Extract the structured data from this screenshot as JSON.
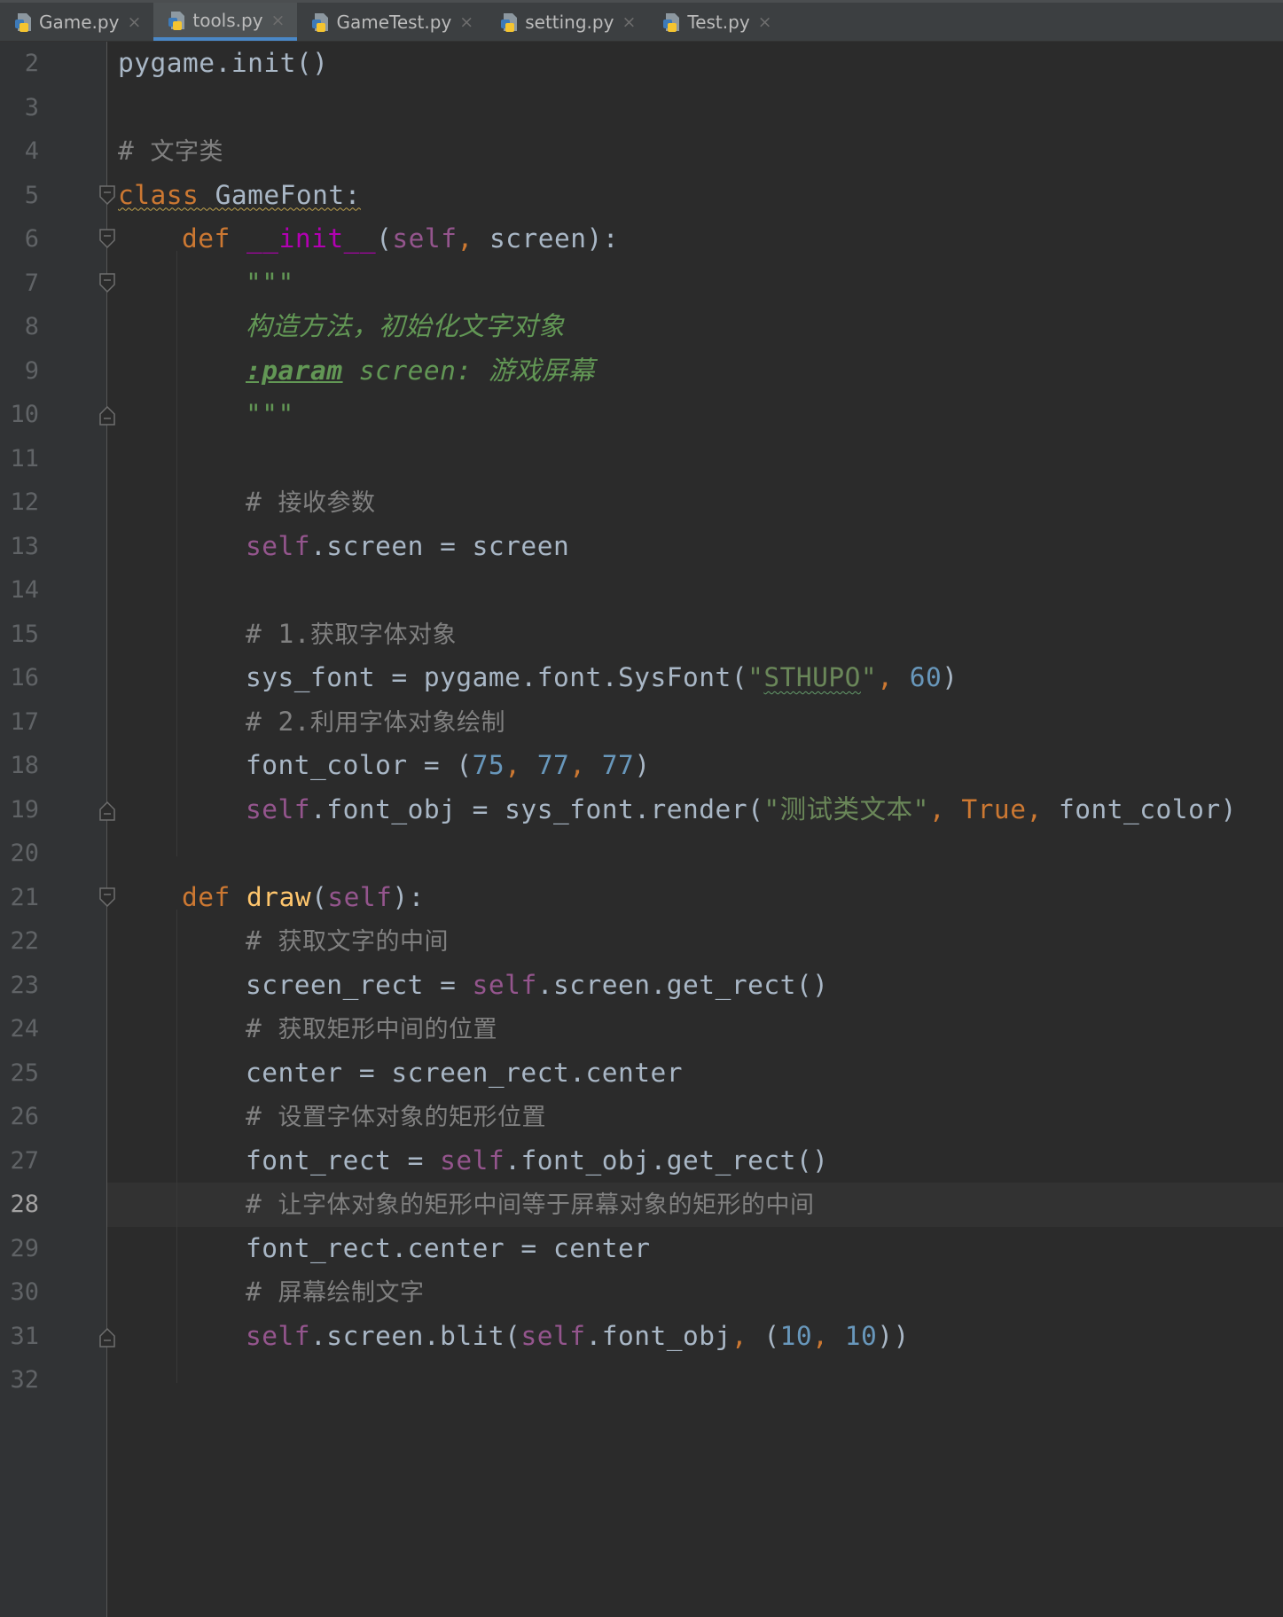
{
  "tabs": [
    {
      "label": "Game.py",
      "active": false
    },
    {
      "label": "tools.py",
      "active": true
    },
    {
      "label": "GameTest.py",
      "active": false
    },
    {
      "label": "setting.py",
      "active": false
    },
    {
      "label": "Test.py",
      "active": false
    }
  ],
  "close_glyph": "×",
  "editor": {
    "current_line": 28,
    "lines": [
      {
        "n": "2",
        "indent": 0,
        "fold": "",
        "tokens": [
          [
            "plain",
            "pygame.init()"
          ]
        ]
      },
      {
        "n": "3",
        "indent": 0,
        "fold": "",
        "tokens": []
      },
      {
        "n": "4",
        "indent": 0,
        "fold": "",
        "tokens": [
          [
            "cmt-mono",
            "# "
          ],
          [
            "cmt",
            "文字类"
          ]
        ]
      },
      {
        "n": "5",
        "indent": 0,
        "fold": "open",
        "tokens": [
          [
            "kw squiggle",
            "class"
          ],
          [
            "plain squiggle",
            " GameFont:"
          ]
        ]
      },
      {
        "n": "6",
        "indent": 1,
        "fold": "open",
        "tokens": [
          [
            "kw",
            "def "
          ],
          [
            "magic",
            "__init__"
          ],
          [
            "plain",
            "("
          ],
          [
            "self",
            "self"
          ],
          [
            "kw",
            ", "
          ],
          [
            "plain",
            "screen):"
          ]
        ]
      },
      {
        "n": "7",
        "indent": 2,
        "fold": "open",
        "tokens": [
          [
            "doc",
            "\"\"\""
          ]
        ]
      },
      {
        "n": "8",
        "indent": 2,
        "fold": "",
        "tokens": [
          [
            "doc",
            "构造方法，初始化文字对象"
          ]
        ]
      },
      {
        "n": "9",
        "indent": 2,
        "fold": "",
        "tokens": [
          [
            "doc-tag",
            ":param"
          ],
          [
            "doc",
            " screen: 游戏屏幕"
          ]
        ]
      },
      {
        "n": "10",
        "indent": 2,
        "fold": "close",
        "tokens": [
          [
            "doc",
            "\"\"\""
          ]
        ]
      },
      {
        "n": "11",
        "indent": 0,
        "fold": "",
        "tokens": []
      },
      {
        "n": "12",
        "indent": 2,
        "fold": "",
        "tokens": [
          [
            "cmt-mono",
            "# "
          ],
          [
            "cmt",
            "接收参数"
          ]
        ]
      },
      {
        "n": "13",
        "indent": 2,
        "fold": "",
        "tokens": [
          [
            "self",
            "self"
          ],
          [
            "plain",
            ".screen = screen"
          ]
        ]
      },
      {
        "n": "14",
        "indent": 0,
        "fold": "",
        "tokens": []
      },
      {
        "n": "15",
        "indent": 2,
        "fold": "",
        "tokens": [
          [
            "cmt-mono",
            "# 1."
          ],
          [
            "cmt",
            "获取字体对象"
          ]
        ]
      },
      {
        "n": "16",
        "indent": 2,
        "fold": "",
        "tokens": [
          [
            "plain",
            "sys_font = pygame.font.SysFont("
          ],
          [
            "str",
            "\""
          ],
          [
            "str squiggle-g",
            "STHUPO"
          ],
          [
            "str",
            "\""
          ],
          [
            "kw",
            ", "
          ],
          [
            "num",
            "60"
          ],
          [
            "plain",
            ")"
          ]
        ]
      },
      {
        "n": "17",
        "indent": 2,
        "fold": "",
        "tokens": [
          [
            "cmt-mono",
            "# 2."
          ],
          [
            "cmt",
            "利用字体对象绘制"
          ]
        ]
      },
      {
        "n": "18",
        "indent": 2,
        "fold": "",
        "tokens": [
          [
            "plain",
            "font_color = ("
          ],
          [
            "num",
            "75"
          ],
          [
            "kw",
            ", "
          ],
          [
            "num",
            "77"
          ],
          [
            "kw",
            ", "
          ],
          [
            "num",
            "77"
          ],
          [
            "plain",
            ")"
          ]
        ]
      },
      {
        "n": "19",
        "indent": 2,
        "fold": "close",
        "tokens": [
          [
            "self",
            "self"
          ],
          [
            "plain",
            ".font_obj = sys_font.render("
          ],
          [
            "str",
            "\"测试类文本\""
          ],
          [
            "kw",
            ", "
          ],
          [
            "kw",
            "True"
          ],
          [
            "kw",
            ", "
          ],
          [
            "plain",
            "font_color)"
          ]
        ]
      },
      {
        "n": "20",
        "indent": 0,
        "fold": "",
        "tokens": []
      },
      {
        "n": "21",
        "indent": 1,
        "fold": "open",
        "tokens": [
          [
            "kw",
            "def "
          ],
          [
            "fn",
            "draw"
          ],
          [
            "plain",
            "("
          ],
          [
            "self",
            "self"
          ],
          [
            "plain",
            "):"
          ]
        ]
      },
      {
        "n": "22",
        "indent": 2,
        "fold": "",
        "tokens": [
          [
            "cmt-mono",
            "# "
          ],
          [
            "cmt",
            "获取文字的中间"
          ]
        ]
      },
      {
        "n": "23",
        "indent": 2,
        "fold": "",
        "tokens": [
          [
            "plain",
            "screen_rect = "
          ],
          [
            "self",
            "self"
          ],
          [
            "plain",
            ".screen.get_rect()"
          ]
        ]
      },
      {
        "n": "24",
        "indent": 2,
        "fold": "",
        "tokens": [
          [
            "cmt-mono",
            "# "
          ],
          [
            "cmt",
            "获取矩形中间的位置"
          ]
        ]
      },
      {
        "n": "25",
        "indent": 2,
        "fold": "",
        "tokens": [
          [
            "plain",
            "center = screen_rect.center"
          ]
        ]
      },
      {
        "n": "26",
        "indent": 2,
        "fold": "",
        "tokens": [
          [
            "cmt-mono",
            "# "
          ],
          [
            "cmt",
            "设置字体对象的矩形位置"
          ]
        ]
      },
      {
        "n": "27",
        "indent": 2,
        "fold": "",
        "tokens": [
          [
            "plain",
            "font_rect = "
          ],
          [
            "self",
            "self"
          ],
          [
            "plain",
            ".font_obj.get_rect()"
          ]
        ]
      },
      {
        "n": "28",
        "indent": 2,
        "fold": "",
        "tokens": [
          [
            "cmt-mono",
            "# "
          ],
          [
            "cmt",
            "让字体对象的矩形中间等于屏幕对象的矩形的中间"
          ]
        ]
      },
      {
        "n": "29",
        "indent": 2,
        "fold": "",
        "tokens": [
          [
            "plain",
            "font_rect.center = center"
          ]
        ]
      },
      {
        "n": "30",
        "indent": 2,
        "fold": "",
        "tokens": [
          [
            "cmt-mono",
            "# "
          ],
          [
            "cmt",
            "屏幕绘制文字"
          ]
        ]
      },
      {
        "n": "31",
        "indent": 2,
        "fold": "close",
        "tokens": [
          [
            "self",
            "self"
          ],
          [
            "plain",
            ".screen.blit("
          ],
          [
            "self",
            "self"
          ],
          [
            "plain",
            ".font_obj"
          ],
          [
            "kw",
            ", "
          ],
          [
            "plain",
            "("
          ],
          [
            "num",
            "10"
          ],
          [
            "kw",
            ", "
          ],
          [
            "num",
            "10"
          ],
          [
            "plain",
            "))"
          ]
        ]
      },
      {
        "n": "32",
        "indent": 0,
        "fold": "",
        "tokens": []
      }
    ]
  }
}
